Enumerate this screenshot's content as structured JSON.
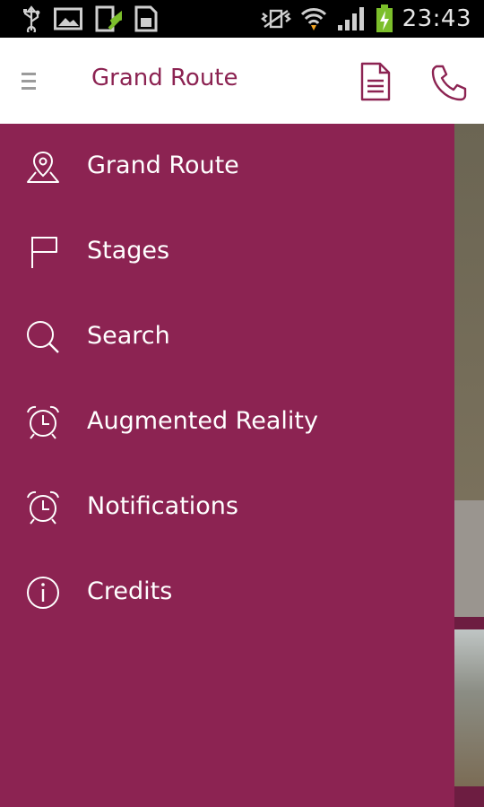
{
  "status_bar": {
    "time": "23:43",
    "icons": [
      "usb-icon",
      "image-icon",
      "download-icon",
      "sd-card-icon",
      "no-vibration-icon",
      "wifi-icon",
      "signal-icon",
      "battery-charging-icon"
    ]
  },
  "app_bar": {
    "title": "Grand Route",
    "icons": [
      "menu-icon",
      "document-icon",
      "phone-icon"
    ]
  },
  "drawer": {
    "background": "#8c2352",
    "items": [
      {
        "label": "Grand Route",
        "icon": "map-pin-icon"
      },
      {
        "label": "Stages",
        "icon": "flag-icon"
      },
      {
        "label": "Search",
        "icon": "search-icon"
      },
      {
        "label": "Augmented Reality",
        "icon": "alarm-clock-icon"
      },
      {
        "label": "Notifications",
        "icon": "alarm-clock-icon"
      },
      {
        "label": "Credits",
        "icon": "info-icon"
      }
    ]
  },
  "colors": {
    "accent": "#8c2352",
    "app_bar_bg": "#ffffff",
    "status_bar_bg": "#000000"
  }
}
